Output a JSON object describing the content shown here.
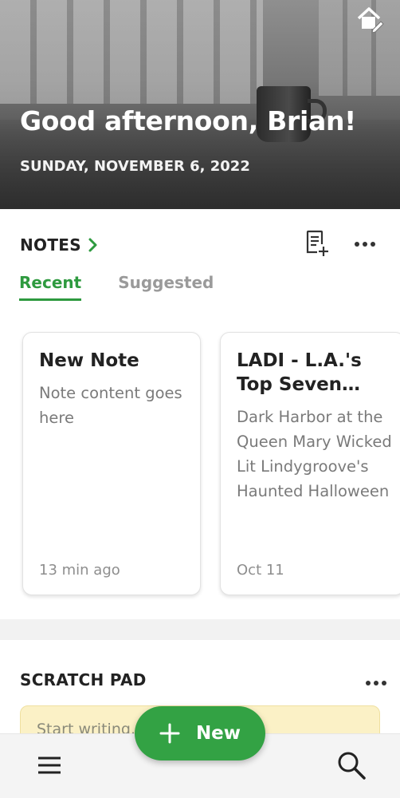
{
  "header": {
    "greeting": "Good afternoon, Brian!",
    "date": "SUNDAY, NOVEMBER 6, 2022",
    "home_icon": "home-customize-icon"
  },
  "notes": {
    "title": "NOTES",
    "tabs": [
      {
        "label": "Recent",
        "active": true
      },
      {
        "label": "Suggested",
        "active": false
      }
    ],
    "cards": [
      {
        "title": "New Note",
        "body": "Note content goes here",
        "date": "13 min ago"
      },
      {
        "title": "LADI - L.A.'s Top Seven Halloween",
        "body": "Dark Harbor at the Queen Mary Wicked Lit Lindygroove's Haunted Halloween",
        "date": "Oct 11"
      }
    ]
  },
  "scratch_pad": {
    "title": "SCRATCH PAD",
    "placeholder": "Start writing…"
  },
  "fab": {
    "label": "New"
  },
  "colors": {
    "accent": "#2e9a3f",
    "fab": "#33a244",
    "scratch_pad_bg": "#fbf1c6"
  }
}
